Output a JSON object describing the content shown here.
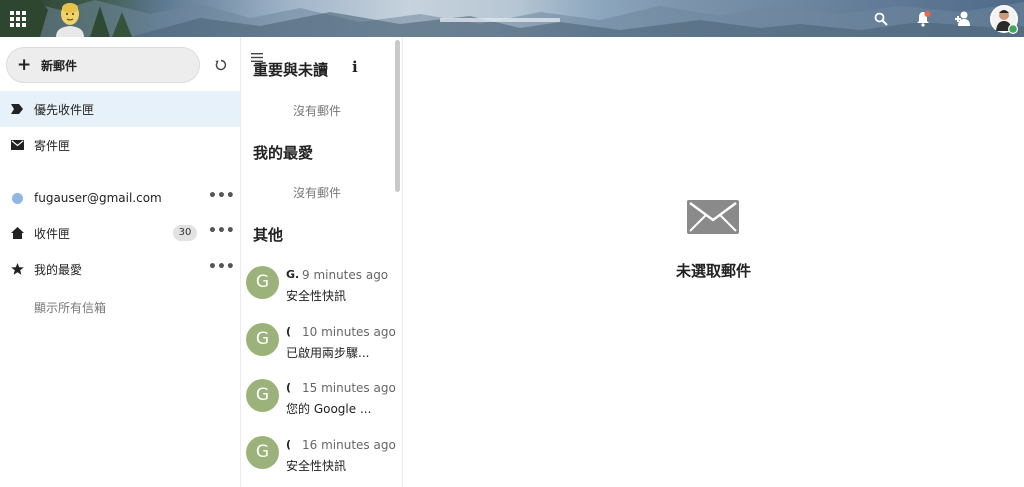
{
  "header": {
    "icons": {
      "apps": "grid-icon",
      "search": "search-icon",
      "notifications": "bell-icon",
      "contacts": "contacts-icon",
      "user": "user-avatar"
    },
    "notification_dot_color": "#e9654a"
  },
  "sidebar": {
    "new_mail_label": "新郵件",
    "items": [
      {
        "label": "優先收件匣",
        "icon": "tag-icon",
        "active": true
      },
      {
        "label": "寄件匣",
        "icon": "envelope-icon"
      }
    ],
    "account": {
      "email": "fugauser@gmail.com",
      "color": "#8eb8e2"
    },
    "folders": [
      {
        "label": "收件匣",
        "icon": "home-icon",
        "count": "30"
      },
      {
        "label": "我的最愛",
        "icon": "star-icon"
      }
    ],
    "show_all_label": "顯示所有信箱",
    "more_label": "•••"
  },
  "list": {
    "sections": {
      "important": {
        "title": "重要與未讀",
        "empty": "沒有郵件"
      },
      "favorites": {
        "title": "我的最愛",
        "empty": "沒有郵件"
      },
      "others": {
        "title": "其他"
      }
    },
    "info_label": "i",
    "messages": [
      {
        "avatar": "G",
        "sender": "G.",
        "time": "9 minutes ago",
        "subject": "安全性快訊"
      },
      {
        "avatar": "G",
        "sender": "(",
        "time": "10 minutes ago",
        "subject": "已啟用兩步驟..."
      },
      {
        "avatar": "G",
        "sender": "(",
        "time": "15 minutes ago",
        "subject": "您的 Google ..."
      },
      {
        "avatar": "G",
        "sender": "(",
        "time": "16 minutes ago",
        "subject": "安全性快訊"
      }
    ],
    "avatar_color": "#9bb27a"
  },
  "pane": {
    "empty_label": "未選取郵件",
    "icon": "envelope-icon"
  }
}
